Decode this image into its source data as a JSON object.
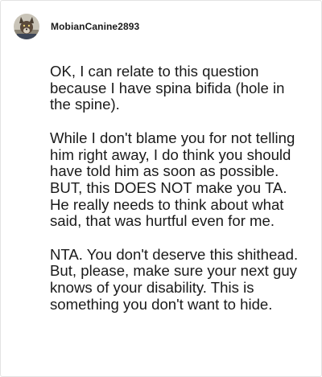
{
  "comment": {
    "author": "MobianCanine2893",
    "avatar_icon": "wolf-avatar-icon",
    "paragraphs": [
      "OK, I can relate to this question because I have spina bifida (hole in the spine).",
      "While I don't blame you for not telling him right away, I do think you should have told him as soon as possible. BUT, this DOES NOT make you TA. He really needs to think about what said, that was hurtful even for me.",
      "NTA. You don't deserve this shithead. But, please, make sure your next guy knows of your disability. This is something you don't want to hide."
    ]
  },
  "colors": {
    "text": "#1a1a1a",
    "border": "#e3e3e3",
    "background": "#ffffff"
  }
}
